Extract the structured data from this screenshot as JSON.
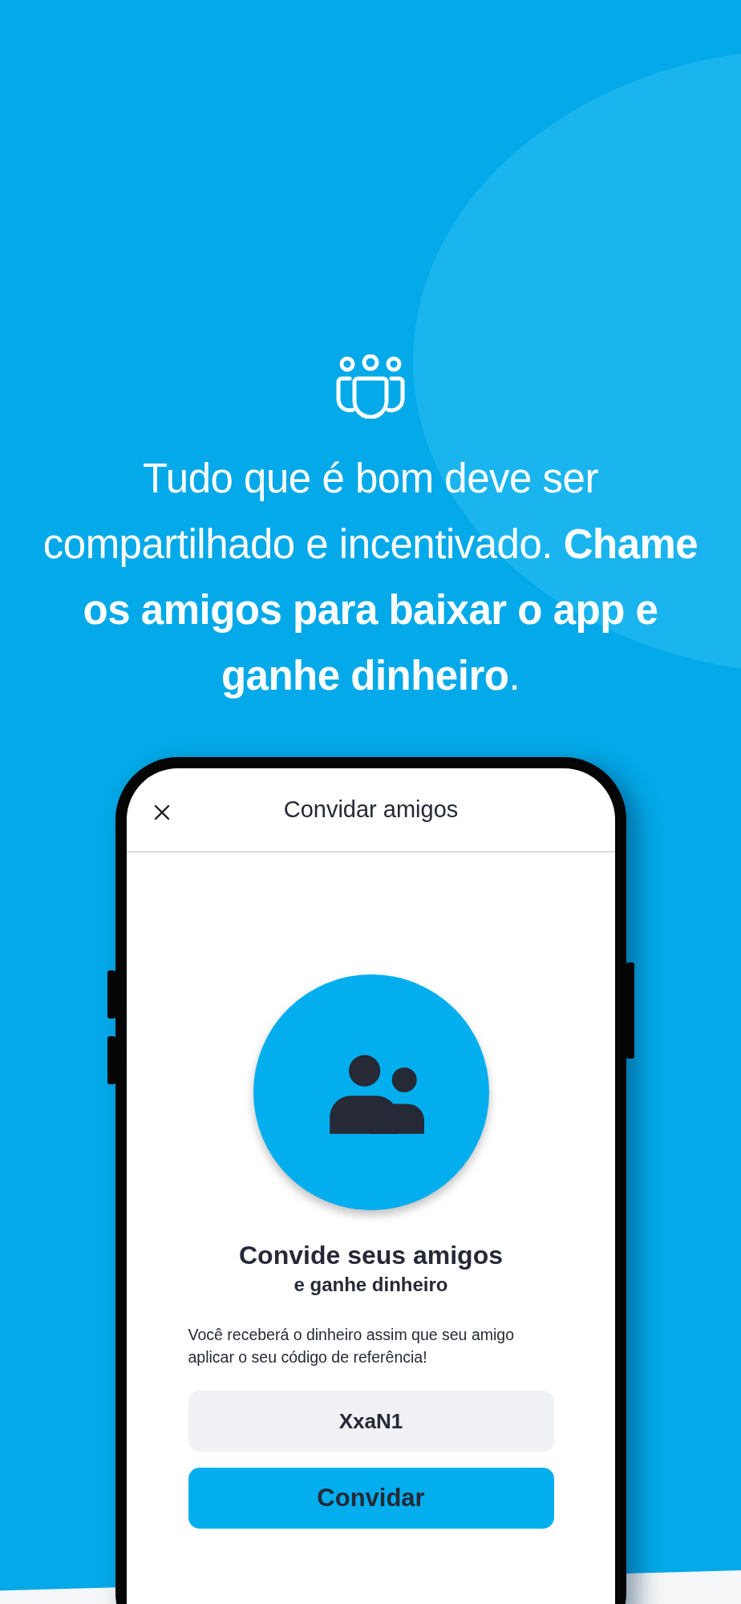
{
  "headline": "Tudo que é bom deve ser compartilhado e incentivado. **Chame os amigos para baixar o app e ganhe dinheiro**.",
  "phone": {
    "screen_title": "Convidar amigos",
    "title": "Convide seus amigos",
    "subtitle": "e ganhe dinheiro",
    "description": "Você receberá o dinheiro assim que seu amigo aplicar o seu código de referência!",
    "referral_code": "XxaN1",
    "button": "Convidar"
  }
}
